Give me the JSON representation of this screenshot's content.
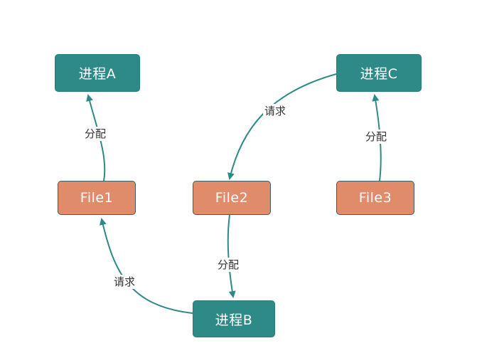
{
  "colors": {
    "process_fill": "#2e8a86",
    "file_fill": "#e08c6a",
    "arrow": "#2e8a86",
    "label_text": "#333333"
  },
  "nodes": {
    "process_a": "进程A",
    "process_b": "进程B",
    "process_c": "进程C",
    "file1": "File1",
    "file2": "File2",
    "file3": "File3"
  },
  "edges": [
    {
      "from": "file1",
      "to": "process_a",
      "label": "分配"
    },
    {
      "from": "process_b",
      "to": "file1",
      "label": "请求"
    },
    {
      "from": "file2",
      "to": "process_b",
      "label": "分配"
    },
    {
      "from": "process_c",
      "to": "file2",
      "label": "请求"
    },
    {
      "from": "file3",
      "to": "process_c",
      "label": "分配"
    }
  ]
}
